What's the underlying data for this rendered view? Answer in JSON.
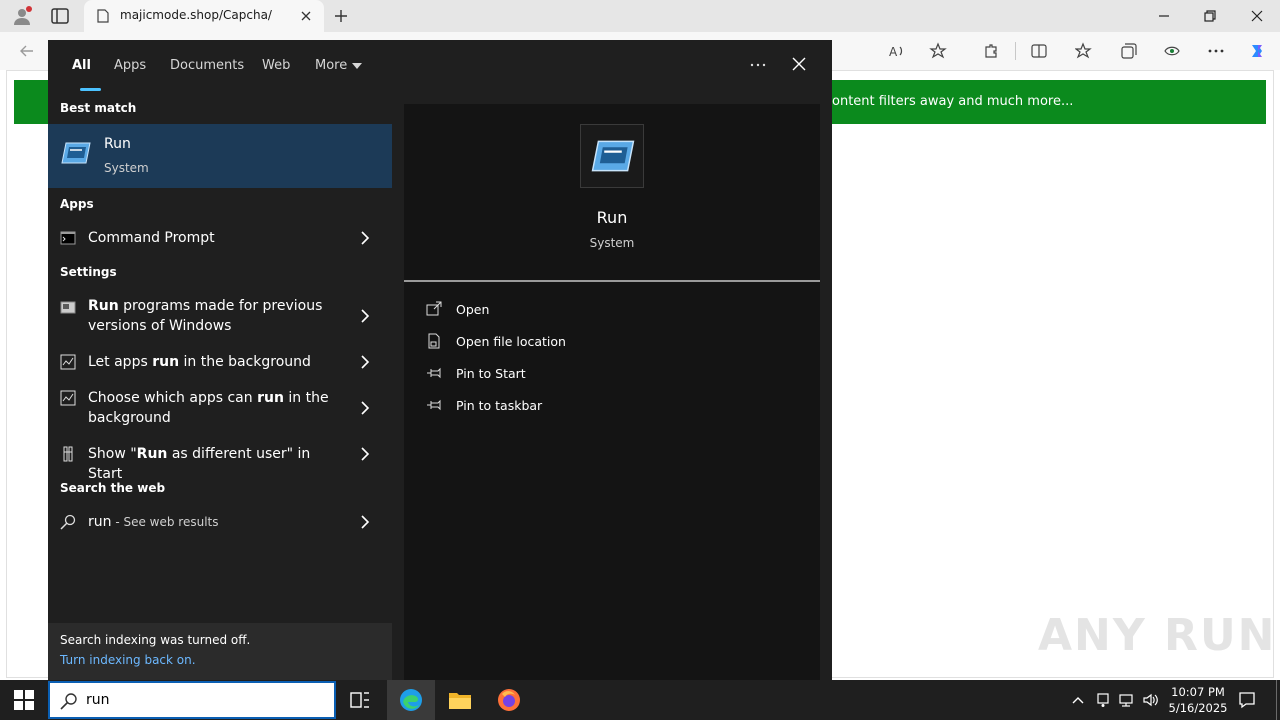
{
  "browser": {
    "tab_title": "majicmode.shop/Capcha/",
    "banner_text": "ontent filters away and much more...",
    "watermark": "ANY RUN",
    "icons": [
      "profile-icon",
      "tab-actions-icon",
      "page-icon",
      "close-icon",
      "plus-icon",
      "minimize-icon",
      "restore-icon",
      "close-icon",
      "back-icon",
      "read-aloud-icon",
      "favorite-star-icon",
      "extensions-icon",
      "split-screen-icon",
      "favorites-icon",
      "collections-icon",
      "browser-essentials-icon",
      "more-icon",
      "copilot-icon"
    ]
  },
  "search": {
    "filters": [
      "All",
      "Apps",
      "Documents",
      "Web",
      "More"
    ],
    "active_filter": "All",
    "best_match_header": "Best match",
    "best_match": {
      "title": "Run",
      "subtitle": "System"
    },
    "apps_header": "Apps",
    "apps": [
      {
        "label": "Command Prompt"
      }
    ],
    "settings_header": "Settings",
    "settings": [
      {
        "bold": "Run",
        "rest": " programs made for previous versions of Windows"
      },
      {
        "pre": "Let apps ",
        "bold": "run",
        "rest": " in the background"
      },
      {
        "pre": "Choose which apps can ",
        "bold": "run",
        "rest": " in the background"
      },
      {
        "pre": "Show \"",
        "bold": "Run",
        "rest": " as different user\" in Start"
      }
    ],
    "web_header": "Search the web",
    "web": {
      "query": "run",
      "suffix": " - See web results"
    },
    "index_notice": "Search indexing was turned off.",
    "index_link": "Turn indexing back on.",
    "preview": {
      "title": "Run",
      "subtitle": "System",
      "actions": [
        "Open",
        "Open file location",
        "Pin to Start",
        "Pin to taskbar"
      ]
    }
  },
  "taskbar": {
    "search_value": "run",
    "time": "10:07 PM",
    "date": "5/16/2025"
  },
  "colors": {
    "panel_bg": "#1f1f1f",
    "selected_bg": "#1c3a57",
    "accent": "#4cc2ff",
    "banner": "#0b8a1d",
    "link": "#6cb8ff"
  }
}
